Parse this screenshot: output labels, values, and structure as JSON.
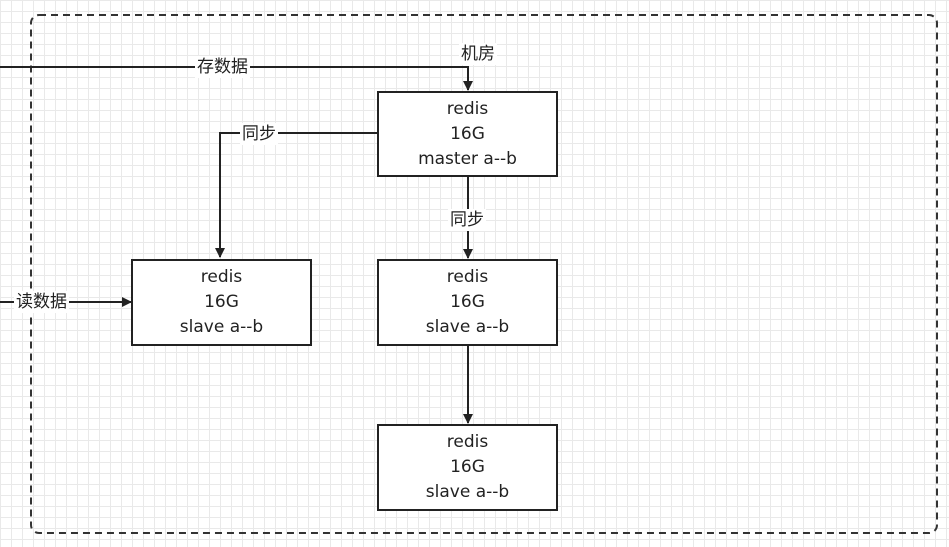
{
  "room_label": "机房",
  "edges": {
    "store": "存数据",
    "sync_left": "同步",
    "sync_down": "同步",
    "read": "读数据"
  },
  "nodes": {
    "master": {
      "name": "redis",
      "memory": "16G",
      "role": "master a--b"
    },
    "slave_left": {
      "name": "redis",
      "memory": "16G",
      "role": "slave a--b"
    },
    "slave_mid": {
      "name": "redis",
      "memory": "16G",
      "role": "slave a--b"
    },
    "slave_bottom": {
      "name": "redis",
      "memory": "16G",
      "role": "slave a--b"
    }
  },
  "colors": {
    "line": "#222222",
    "grid": "#e9e9e9",
    "boundary": "#333333"
  }
}
